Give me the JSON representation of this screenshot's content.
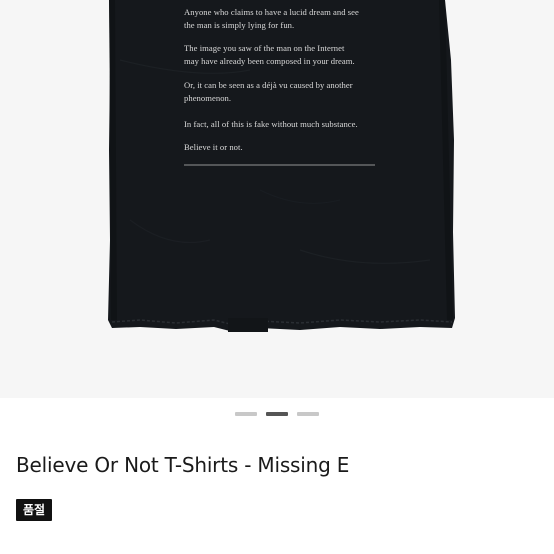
{
  "product": {
    "image_alt": "Black t-shirt back print",
    "print_lines": [
      "Anyone who claims to have a lucid dream and see\nthe man is simply lying for fun.",
      "The image you saw of the man on the Internet\nmay have already been composed in your dream.",
      "Or, it can be seen as a déjà vu caused by another\nphenomenon.",
      "In fact, all of this is fake without much substance.",
      "Believe it or not."
    ],
    "title": "Believe Or Not T-Shirts - Missing E",
    "status_badge": "품절"
  },
  "gallery": {
    "total": 3,
    "active_index": 2
  },
  "colors": {
    "shirt": "#15181c",
    "gallery_background": "#f6f6f6",
    "dot_inactive": "#c8c8c8",
    "dot_active": "#555555",
    "badge_background": "#111111"
  }
}
